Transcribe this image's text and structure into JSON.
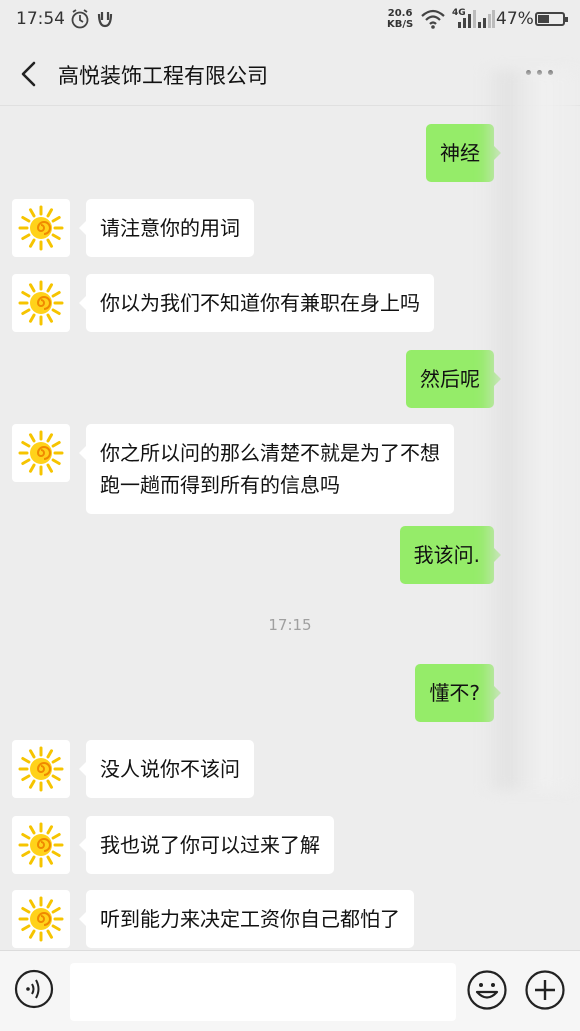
{
  "status_bar": {
    "time": "17:54",
    "net_speed_value": "20.6",
    "net_speed_unit": "KB/S",
    "signal_label": "4G",
    "battery": "47%",
    "battery_level": 0.47
  },
  "header": {
    "title": "高悦装饰工程有限公司",
    "back_icon": "chevron-left-icon",
    "more_icon": "more-dots-icon"
  },
  "messages": [
    {
      "side": "out",
      "text": "神经"
    },
    {
      "side": "in",
      "text": "请注意你的用词"
    },
    {
      "side": "in",
      "text": "你以为我们不知道你有兼职在身上吗"
    },
    {
      "side": "out",
      "text": "然后呢"
    },
    {
      "side": "in",
      "lines": [
        "你之所以问的那么清楚不就是为了不想",
        "跑一趟而得到所有的信息吗"
      ]
    },
    {
      "side": "out",
      "text": "我该问."
    },
    {
      "timestamp": "17:15"
    },
    {
      "side": "out",
      "text": "懂不?"
    },
    {
      "side": "in",
      "text": "没人说你不该问"
    },
    {
      "side": "in",
      "text": "我也说了你可以过来了解"
    },
    {
      "side": "in",
      "text": "听到能力来决定工资你自己都怕了"
    }
  ],
  "input_bar": {
    "voice_icon": "voice-icon",
    "input_value": "",
    "emoji_icon": "emoji-icon",
    "plus_icon": "plus-icon"
  },
  "colors": {
    "outgoing_bubble": "#95ec69",
    "incoming_bubble": "#ffffff",
    "background": "#ededed"
  }
}
